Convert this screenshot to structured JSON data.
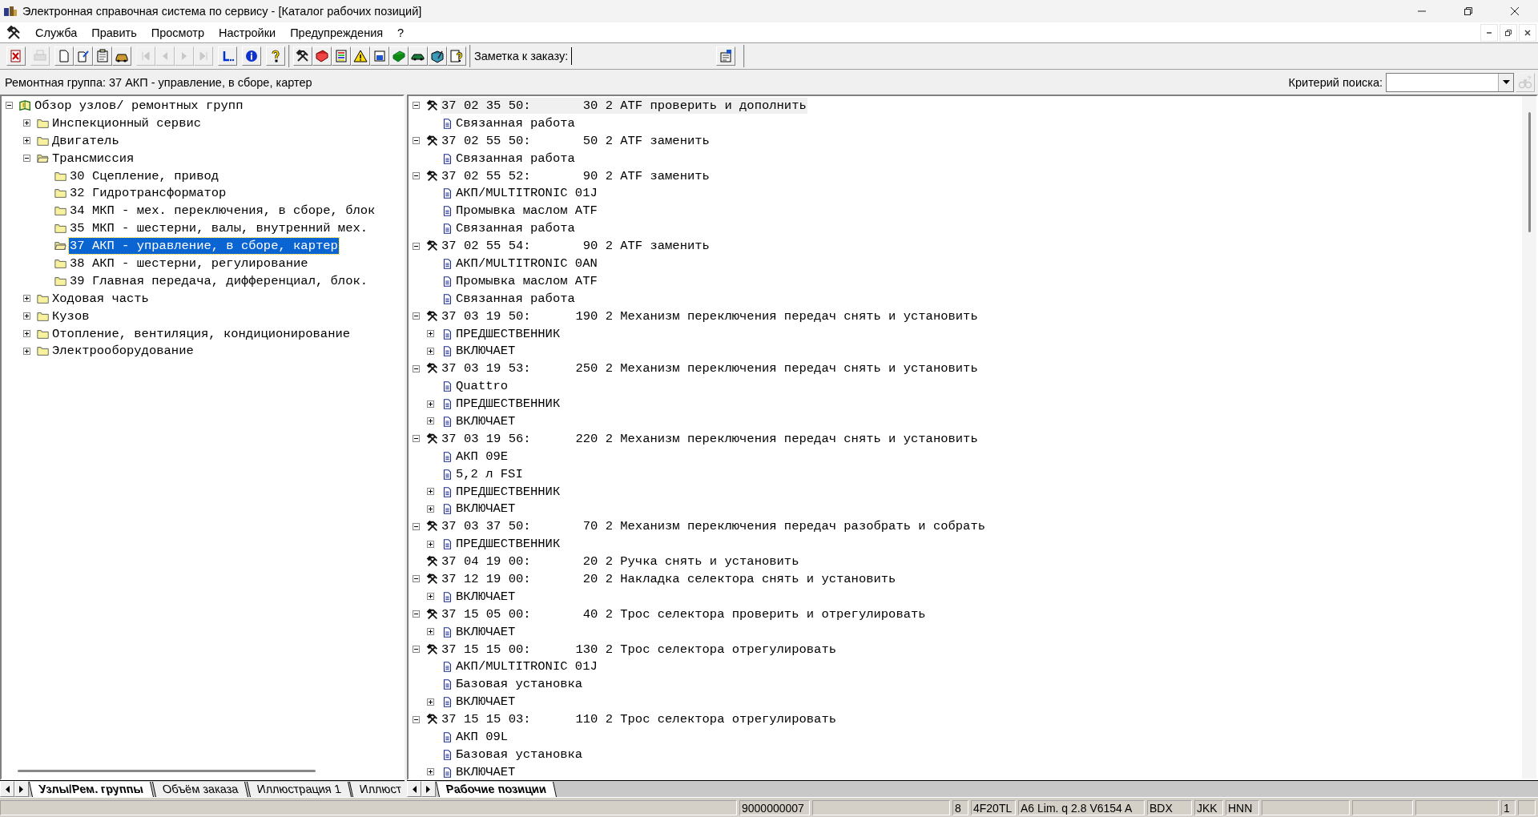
{
  "window": {
    "title": "Электронная справочная система по сервису - [Каталог рабочих позиций]"
  },
  "menu": [
    {
      "label": "Служба"
    },
    {
      "label": "Править"
    },
    {
      "label": "Просмотр"
    },
    {
      "label": "Настройки"
    },
    {
      "label": "Предупреждения"
    },
    {
      "label": "?"
    }
  ],
  "toolbar": {
    "sections": [
      [
        [
          {
            "kind": "exit",
            "disabled": false
          }
        ],
        [
          {
            "kind": "print",
            "disabled": true
          }
        ],
        [
          {
            "kind": "new",
            "disabled": false
          },
          {
            "kind": "edit",
            "disabled": false
          },
          {
            "kind": "paste",
            "disabled": false
          },
          {
            "kind": "car",
            "disabled": false
          }
        ],
        [
          {
            "kind": "first",
            "disabled": true
          },
          {
            "kind": "prev",
            "disabled": true
          },
          {
            "kind": "next",
            "disabled": true
          },
          {
            "kind": "last",
            "disabled": true
          }
        ],
        [
          {
            "kind": "jump",
            "disabled": false
          }
        ],
        [
          {
            "kind": "info",
            "disabled": false
          }
        ],
        [
          {
            "kind": "help",
            "disabled": false
          }
        ]
      ],
      [
        [
          {
            "kind": "tools",
            "disabled": false
          },
          {
            "kind": "book",
            "disabled": false
          },
          {
            "kind": "list",
            "disabled": false
          },
          {
            "kind": "warning",
            "disabled": false
          },
          {
            "kind": "box",
            "disabled": false
          },
          {
            "kind": "green",
            "disabled": false
          },
          {
            "kind": "vehicle",
            "disabled": false
          },
          {
            "kind": "manual",
            "disabled": false
          },
          {
            "kind": "query",
            "disabled": false
          }
        ]
      ]
    ],
    "note": {
      "label": "Заметка к заказу:"
    }
  },
  "info_bar": {
    "group": "Ремонтная группа: 37 АКП - управление, в сборе, картер",
    "search_label": "Критерий поиска:"
  },
  "left_tree": [
    {
      "kind": "book",
      "label": "Обзор узлов/ ремонтных групп",
      "expanded": true,
      "selected": false,
      "children": [
        {
          "kind": "folder",
          "label": "Инспекционный сервис",
          "expanded": false,
          "selected": false
        },
        {
          "kind": "folder",
          "label": "Двигатель",
          "expanded": false,
          "selected": false
        },
        {
          "kind": "folder",
          "label": "Трансмиссия",
          "expanded": true,
          "selected": false,
          "children": [
            {
              "kind": "folder",
              "label": "30 Сцепление, привод",
              "selected": false
            },
            {
              "kind": "folder",
              "label": "32 Гидротрансформатор",
              "selected": false
            },
            {
              "kind": "folder",
              "label": "34 МКП - мех. переключения, в сборе, блок",
              "selected": false
            },
            {
              "kind": "folder",
              "label": "35 МКП - шестерни, валы, внутренний мех.",
              "selected": false
            },
            {
              "kind": "folder",
              "label": "37 АКП - управление, в сборе, картер",
              "selected": true
            },
            {
              "kind": "folder",
              "label": "38 АКП - шестерни, регулирование",
              "selected": false
            },
            {
              "kind": "folder",
              "label": "39 Главная передача, дифференциал, блок.",
              "selected": false
            }
          ]
        },
        {
          "kind": "folder",
          "label": "Ходовая часть",
          "expanded": false,
          "selected": false
        },
        {
          "kind": "folder",
          "label": "Кузов",
          "expanded": false,
          "selected": false
        },
        {
          "kind": "folder",
          "label": "Отопление, вентиляция, кондиционирование",
          "expanded": false,
          "selected": false
        },
        {
          "kind": "folder",
          "label": "Электрооборудование",
          "expanded": false,
          "selected": false
        }
      ]
    }
  ],
  "left_tabs": [
    {
      "label": "Узлы/Рем. группы",
      "selected": true
    },
    {
      "label": "Объём заказа",
      "selected": false
    },
    {
      "label": "Иллюстрация 1",
      "selected": false
    },
    {
      "label": "Иллюст",
      "selected": false
    }
  ],
  "work_items": [
    {
      "kind": "job",
      "label": "37 02 35 50:       30 2 ATF проверить и дополнить",
      "expanded": true,
      "selected": true,
      "children": [
        {
          "kind": "note",
          "label": "Связанная работа",
          "selected": false
        }
      ]
    },
    {
      "kind": "job",
      "label": "37 02 55 50:       50 2 ATF заменить",
      "expanded": true,
      "selected": false,
      "children": [
        {
          "kind": "note",
          "label": "Связанная работа",
          "selected": false
        }
      ]
    },
    {
      "kind": "job",
      "label": "37 02 55 52:       90 2 ATF заменить",
      "expanded": true,
      "selected": false,
      "children": [
        {
          "kind": "note",
          "label": "АКП/MULTITRONIC 01J",
          "selected": false
        },
        {
          "kind": "note",
          "label": "Промывка маслом ATF",
          "selected": false
        },
        {
          "kind": "note",
          "label": "Связанная работа",
          "selected": false
        }
      ]
    },
    {
      "kind": "job",
      "label": "37 02 55 54:       90 2 ATF заменить",
      "expanded": true,
      "selected": false,
      "children": [
        {
          "kind": "note",
          "label": "АКП/MULTITRONIC 0AN",
          "selected": false
        },
        {
          "kind": "note",
          "label": "Промывка маслом ATF",
          "selected": false
        },
        {
          "kind": "note",
          "label": "Связанная работа",
          "selected": false
        }
      ]
    },
    {
      "kind": "job",
      "label": "37 03 19 50:      190 2 Механизм переключения передач снять и установить",
      "expanded": true,
      "selected": false,
      "children": [
        {
          "kind": "note",
          "label": "ПРЕДШЕСТВЕННИК",
          "expanded": false,
          "selected": false
        },
        {
          "kind": "note",
          "label": "ВКЛЮЧАЕТ",
          "expanded": false,
          "selected": false
        }
      ]
    },
    {
      "kind": "job",
      "label": "37 03 19 53:      250 2 Механизм переключения передач снять и установить",
      "expanded": true,
      "selected": false,
      "children": [
        {
          "kind": "note",
          "label": "Quattro",
          "selected": false
        },
        {
          "kind": "note",
          "label": "ПРЕДШЕСТВЕННИК",
          "expanded": false,
          "selected": false
        },
        {
          "kind": "note",
          "label": "ВКЛЮЧАЕТ",
          "expanded": false,
          "selected": false
        }
      ]
    },
    {
      "kind": "job",
      "label": "37 03 19 56:      220 2 Механизм переключения передач снять и установить",
      "expanded": true,
      "selected": false,
      "children": [
        {
          "kind": "note",
          "label": "АКП 09E",
          "selected": false
        },
        {
          "kind": "note",
          "label": "5,2 л FSI",
          "selected": false
        },
        {
          "kind": "note",
          "label": "ПРЕДШЕСТВЕННИК",
          "expanded": false,
          "selected": false
        },
        {
          "kind": "note",
          "label": "ВКЛЮЧАЕТ",
          "expanded": false,
          "selected": false
        }
      ]
    },
    {
      "kind": "job",
      "label": "37 03 37 50:       70 2 Механизм переключения передач разобрать и собрать",
      "expanded": true,
      "selected": false,
      "children": [
        {
          "kind": "note",
          "label": "ПРЕДШЕСТВЕННИК",
          "expanded": false,
          "selected": false
        }
      ]
    },
    {
      "kind": "job",
      "label": "37 04 19 00:       20 2 Ручка снять и установить",
      "selected": false
    },
    {
      "kind": "job",
      "label": "37 12 19 00:       20 2 Накладка селектора снять и установить",
      "expanded": true,
      "selected": false,
      "children": [
        {
          "kind": "note",
          "label": "ВКЛЮЧАЕТ",
          "expanded": false,
          "selected": false
        }
      ]
    },
    {
      "kind": "job",
      "label": "37 15 05 00:       40 2 Трос селектора проверить и отрегулировать",
      "expanded": true,
      "selected": false,
      "children": [
        {
          "kind": "note",
          "label": "ВКЛЮЧАЕТ",
          "expanded": false,
          "selected": false
        }
      ]
    },
    {
      "kind": "job",
      "label": "37 15 15 00:      130 2 Трос селектора отрегулировать",
      "expanded": true,
      "selected": false,
      "children": [
        {
          "kind": "note",
          "label": "АКП/MULTITRONIC 01J",
          "selected": false
        },
        {
          "kind": "note",
          "label": "Базовая установка",
          "selected": false
        },
        {
          "kind": "note",
          "label": "ВКЛЮЧАЕТ",
          "expanded": false,
          "selected": false
        }
      ]
    },
    {
      "kind": "job",
      "label": "37 15 15 03:      110 2 Трос селектора отрегулировать",
      "expanded": true,
      "selected": false,
      "children": [
        {
          "kind": "note",
          "label": "АКП 09L",
          "selected": false
        },
        {
          "kind": "note",
          "label": "Базовая установка",
          "selected": false
        },
        {
          "kind": "note",
          "label": "ВКЛЮЧАЕТ",
          "expanded": false,
          "selected": false
        }
      ]
    }
  ],
  "right_tabs": [
    {
      "label": "Рабочие позиции",
      "selected": true
    }
  ],
  "status_bar": [
    {
      "kind": "empty"
    },
    {
      "kind": "text",
      "text": "9000000007"
    },
    {
      "kind": "empty"
    },
    {
      "kind": "text",
      "text": "8"
    },
    {
      "kind": "text",
      "text": "4F20TL"
    },
    {
      "kind": "text",
      "text": "A6 Lim. q 2.8 V6154 A"
    },
    {
      "kind": "text",
      "text": "BDX"
    },
    {
      "kind": "text",
      "text": "JKK"
    },
    {
      "kind": "text",
      "text": "HNN"
    },
    {
      "kind": "empty"
    },
    {
      "kind": "empty"
    },
    {
      "kind": "empty"
    },
    {
      "kind": "text",
      "text": "1"
    },
    {
      "kind": "empty"
    }
  ]
}
